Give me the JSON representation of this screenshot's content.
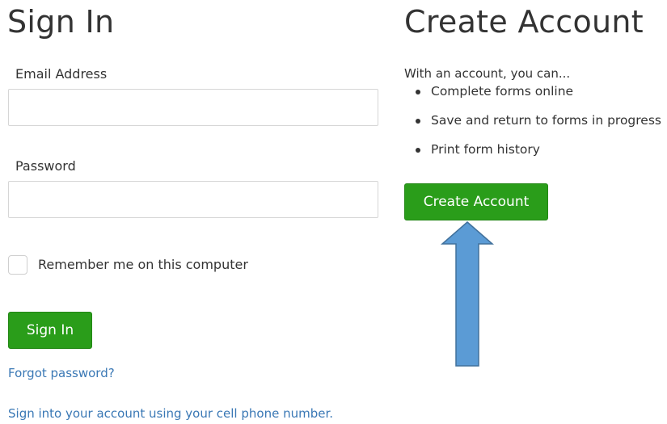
{
  "signin": {
    "heading": "Sign In",
    "email_label": "Email Address",
    "email_value": "",
    "password_label": "Password",
    "password_value": "",
    "remember_label": "Remember me on this computer",
    "remember_checked": false,
    "submit_label": "Sign In",
    "forgot_link": "Forgot password?",
    "phone_link": "Sign into your account using your cell phone number."
  },
  "create": {
    "heading": "Create Account",
    "intro": "With an account, you can...",
    "benefits": [
      "Complete forms online",
      "Save and return to forms in progress",
      "Print form history"
    ],
    "button_label": "Create Account"
  },
  "annotation": {
    "icon": "up-arrow-icon",
    "color": "#5b9bd5",
    "points_to": "create-account-button"
  },
  "colors": {
    "button_green": "#2a9d1a",
    "link_blue": "#3a78b5",
    "arrow_fill": "#5b9bd5",
    "arrow_stroke": "#41719c"
  }
}
